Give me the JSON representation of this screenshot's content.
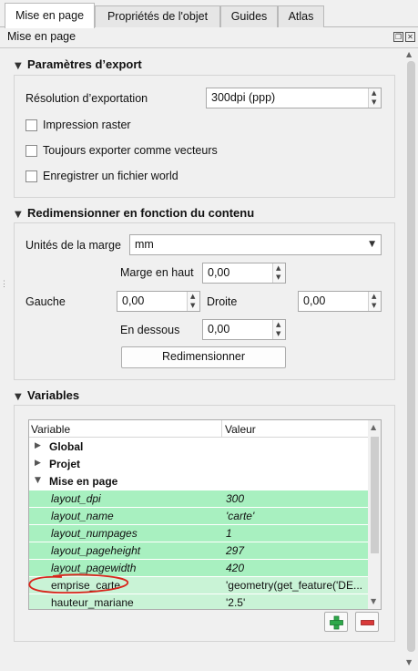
{
  "tabs": [
    {
      "label": "Mise en page",
      "active": true
    },
    {
      "label": "Propriétés de l'objet",
      "active": false
    },
    {
      "label": "Guides",
      "active": false
    },
    {
      "label": "Atlas",
      "active": false
    }
  ],
  "dock": {
    "title": "Mise en page",
    "float_icon": "float-icon",
    "close_icon": "close-icon"
  },
  "export": {
    "header": "Paramètres d’export",
    "resolution_label": "Résolution d’exportation",
    "resolution_value": "300dpi (ppp)",
    "raster_label": "Impression raster",
    "vector_label": "Toujours exporter comme vecteurs",
    "world_label": "Enregistrer un fichier world"
  },
  "resize": {
    "header": "Redimensionner en fonction du contenu",
    "units_label": "Unités de la marge",
    "units_value": "mm",
    "top_label": "Marge en haut",
    "top_value": "0,00",
    "left_label": "Gauche",
    "left_value": "0,00",
    "right_label": "Droite",
    "right_value": "0,00",
    "bottom_label": "En dessous",
    "bottom_value": "0,00",
    "button_label": "Redimensionner"
  },
  "variables": {
    "header": "Variables",
    "col_variable": "Variable",
    "col_value": "Valeur",
    "groups": [
      "Global",
      "Projet",
      "Mise en page"
    ],
    "rows": [
      {
        "name": "layout_dpi",
        "value": "300"
      },
      {
        "name": "layout_name",
        "value": "'carte'"
      },
      {
        "name": "layout_numpages",
        "value": "1"
      },
      {
        "name": "layout_pageheight",
        "value": "297"
      },
      {
        "name": "layout_pagewidth",
        "value": "420"
      },
      {
        "name": "emprise_carte",
        "value": "'geometry(get_feature('DE..."
      },
      {
        "name": "hauteur_mariane",
        "value": "'2.5'"
      }
    ],
    "add_icon": "plus-icon",
    "remove_icon": "minus-icon",
    "annotation_color": "#d9241b"
  },
  "colors": {
    "row_green": "#a8f0c0",
    "row_lightgreen": "#c9f3d6",
    "add_green": "#2ea84a",
    "remove_red": "#d93a3a"
  }
}
